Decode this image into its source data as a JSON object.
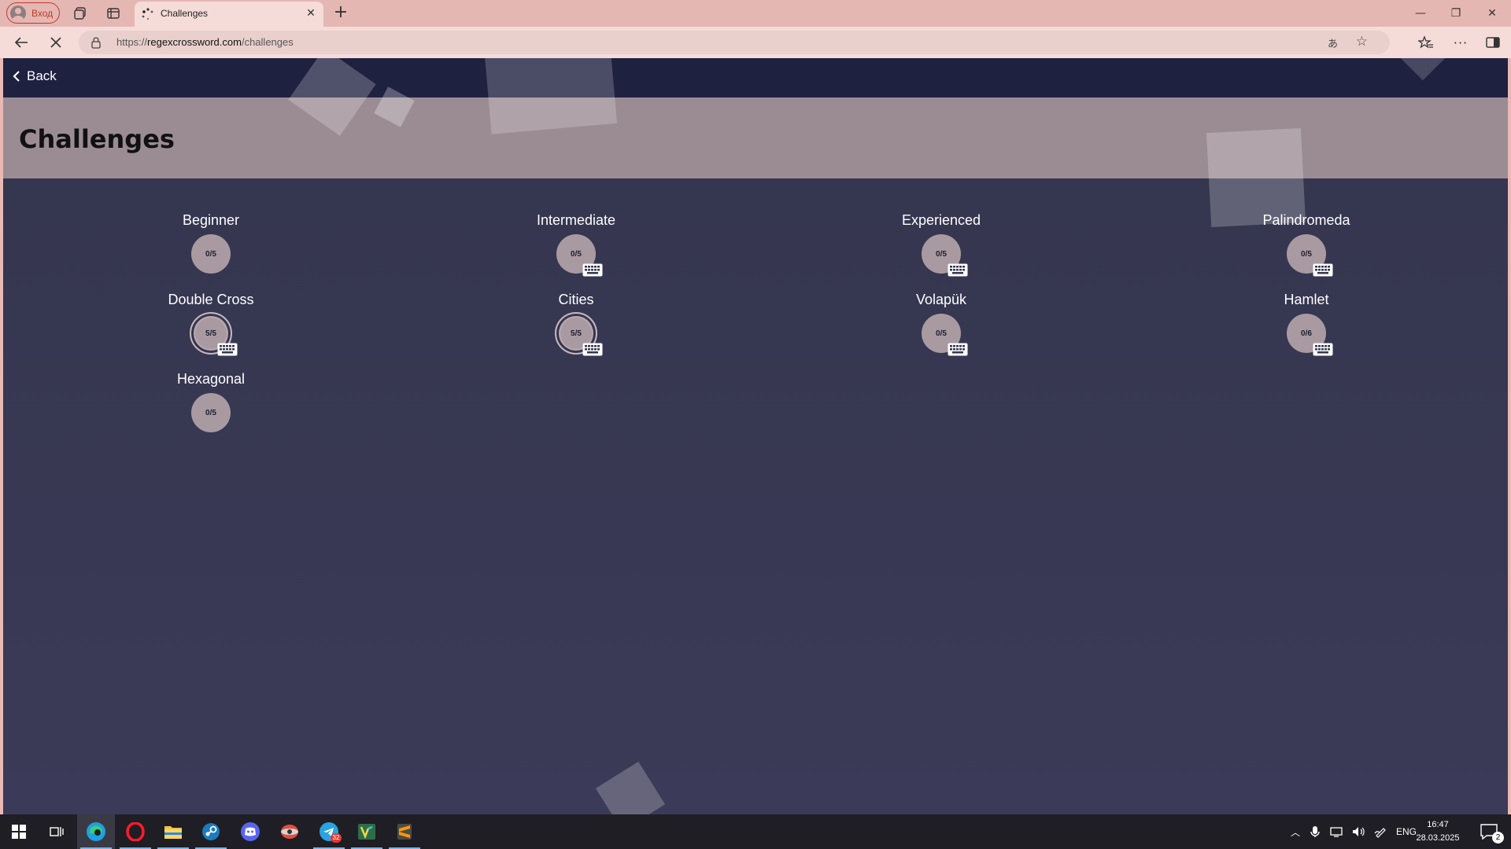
{
  "browser": {
    "profile_label": "Вход",
    "tab_title": "Challenges",
    "url_prefix": "https://",
    "url_host": "regexcrossword.com",
    "url_path": "/challenges"
  },
  "page": {
    "back_label": "Back",
    "title": "Challenges"
  },
  "challenges": [
    {
      "name": "Beginner",
      "progress": "0/5",
      "completed": false,
      "has_keyboard": false
    },
    {
      "name": "Intermediate",
      "progress": "0/5",
      "completed": false,
      "has_keyboard": true
    },
    {
      "name": "Experienced",
      "progress": "0/5",
      "completed": false,
      "has_keyboard": true
    },
    {
      "name": "Palindromeda",
      "progress": "0/5",
      "completed": false,
      "has_keyboard": true
    },
    {
      "name": "Double Cross",
      "progress": "5/5",
      "completed": true,
      "has_keyboard": true
    },
    {
      "name": "Cities",
      "progress": "5/5",
      "completed": true,
      "has_keyboard": true
    },
    {
      "name": "Volapük",
      "progress": "0/5",
      "completed": false,
      "has_keyboard": true
    },
    {
      "name": "Hamlet",
      "progress": "0/6",
      "completed": false,
      "has_keyboard": true
    },
    {
      "name": "Hexagonal",
      "progress": "0/5",
      "completed": false,
      "has_keyboard": false
    }
  ],
  "taskbar": {
    "language": "ENG",
    "time": "16:47",
    "date": "28.03.2025",
    "notification_count": "2",
    "telegram_badge": "32"
  },
  "colors": {
    "page_bg": "#35364f",
    "topnav_bg": "#1f2140",
    "header_band": "#9b8c94",
    "progress_circle": "#a99aa2",
    "chrome_bg": "#e5b7b3"
  }
}
